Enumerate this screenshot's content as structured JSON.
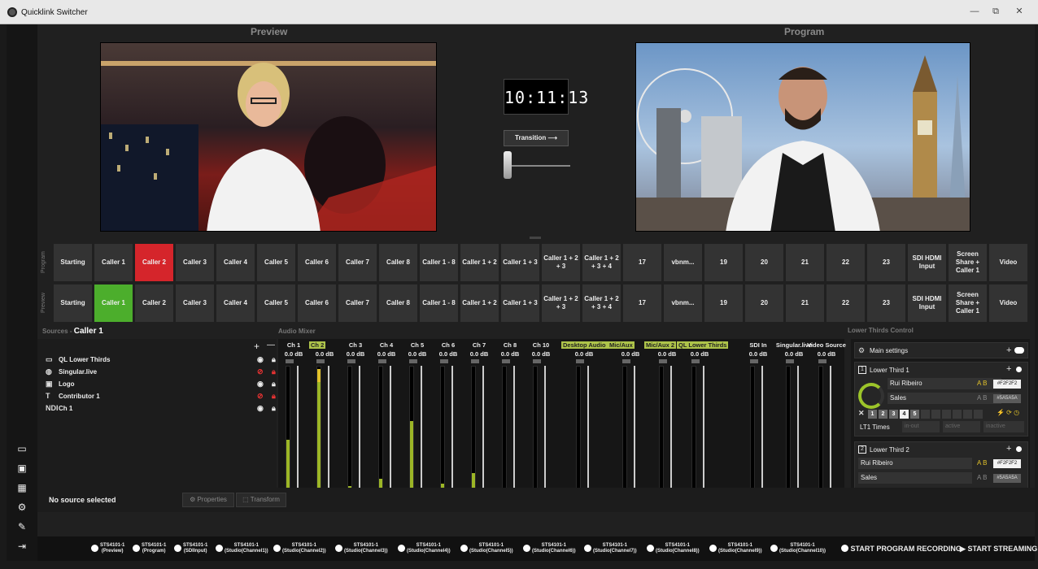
{
  "window": {
    "title": "Quicklink Switcher",
    "min": "—",
    "max": "⧉",
    "close": "✕"
  },
  "headers": {
    "preview": "Preview",
    "program": "Program"
  },
  "clock": "10:11:13",
  "transition_label": "Transition ⟶",
  "row_labels": {
    "program": "Program",
    "preview": "Preview"
  },
  "sources": [
    "Starting",
    "Caller 1",
    "Caller 2",
    "Caller 3",
    "Caller 4",
    "Caller 5",
    "Caller 6",
    "Caller 7",
    "Caller 8",
    "Caller 1 - 8",
    "Caller 1 + 2",
    "Caller 1 + 3",
    "Caller 1 + 2 + 3",
    "Caller 1 + 2 + 3 + 4",
    "17",
    "vbnm...",
    "19",
    "20",
    "21",
    "22",
    "23",
    "SDI HDMI Input",
    "Screen Share + Caller 1",
    "Video"
  ],
  "program_active": "Caller 2",
  "preview_active": "Caller 1",
  "sources_header": {
    "label": "Sources",
    "sep": "-",
    "current": "Caller 1"
  },
  "source_list": [
    {
      "name": "QL Lower Thirds",
      "icon": "▭",
      "hidden": false
    },
    {
      "name": "Singular.live",
      "icon": "◍",
      "hidden": true
    },
    {
      "name": "Logo",
      "icon": "▣",
      "hidden": false
    },
    {
      "name": "Contributor 1",
      "icon": "T",
      "hidden": true
    },
    {
      "name": "Ch 1",
      "icon": "NDI",
      "hidden": false
    }
  ],
  "source_controls": {
    "add": "+",
    "remove": "—"
  },
  "audio_mixer_label": "Audio Mixer",
  "mixer_channels": [
    {
      "name": "Ch 1",
      "db": "0.0 dB",
      "level": 0.44,
      "peak": 0,
      "hl": false,
      "muted": false
    },
    {
      "name": "Ch 2",
      "db": "0.0 dB",
      "level": 0.88,
      "peak": 0.1,
      "hl": true,
      "muted": false
    },
    {
      "name": "Ch 3",
      "db": "0.0 dB",
      "level": 0.08,
      "peak": 0,
      "hl": false,
      "muted": false
    },
    {
      "name": "Ch 4",
      "db": "0.0 dB",
      "level": 0.14,
      "peak": 0,
      "hl": false,
      "muted": false
    },
    {
      "name": "Ch 5",
      "db": "0.0 dB",
      "level": 0.58,
      "peak": 0,
      "hl": false,
      "muted": false
    },
    {
      "name": "Ch 6",
      "db": "0.0 dB",
      "level": 0.1,
      "peak": 0,
      "hl": false,
      "muted": false
    },
    {
      "name": "Ch 7",
      "db": "0.0 dB",
      "level": 0.18,
      "peak": 0,
      "hl": false,
      "muted": false
    },
    {
      "name": "Ch 8",
      "db": "0.0 dB",
      "level": 0.03,
      "peak": 0,
      "hl": false,
      "muted": false
    },
    {
      "name": "Ch 10",
      "db": "0.0 dB",
      "level": 0.07,
      "peak": 0,
      "hl": false,
      "muted": false
    },
    {
      "name": "Desktop Audio",
      "db": "0.0 dB",
      "level": 0,
      "peak": 0,
      "hl": true,
      "muted": true
    },
    {
      "name": "Mic/Aux",
      "db": "0.0 dB",
      "level": 0,
      "peak": 0,
      "hl": true,
      "muted": true
    },
    {
      "name": "Mic/Aux 2",
      "db": "0.0 dB",
      "level": 0,
      "peak": 0,
      "hl": true,
      "muted": true
    },
    {
      "name": "QL Lower Thirds",
      "db": "0.0 dB",
      "level": 0,
      "peak": 0,
      "hl": true,
      "muted": false
    },
    {
      "name": "SDI In",
      "db": "0.0 dB",
      "level": 0,
      "peak": 0,
      "hl": false,
      "muted": false
    },
    {
      "name": "Singular.live",
      "db": "0.0 dB",
      "level": 0,
      "peak": 0,
      "hl": false,
      "muted": false
    },
    {
      "name": "Video Source",
      "db": "0.0 dB",
      "level": 0,
      "peak": 0,
      "hl": false,
      "muted": false
    }
  ],
  "lower_thirds": {
    "label": "Lower Thirds Control",
    "main_settings": "Main settings",
    "items": [
      {
        "num": "1",
        "title": "Lower Third 1",
        "name": "Rui Ribeiro",
        "role": "Sales",
        "color1": "#F2F2F2",
        "color2": "#5A5A5A",
        "times_label": "LT1 Times",
        "in_out": "in-out",
        "active": "active",
        "inactive": "inactive"
      },
      {
        "num": "2",
        "title": "Lower Third 2",
        "name": "Rui Ribeiro",
        "role": "Sales",
        "color1": "#F2F2F2",
        "color2": "#5A5A5A"
      }
    ],
    "presets": [
      "1",
      "2",
      "3",
      "4",
      "5"
    ],
    "presets2": [
      "1",
      "2",
      "3",
      "4"
    ]
  },
  "bottom": {
    "no_source": "No source selected",
    "properties": "Properties",
    "transform": "Transform"
  },
  "recorders": [
    [
      "STS4101-1",
      "(Preview)"
    ],
    [
      "STS4101-1",
      "(Program)"
    ],
    [
      "STS4101-1",
      "(SDIInput)"
    ],
    [
      "STS4101-1",
      "(Studio(Channel1))"
    ],
    [
      "STS4101-1",
      "(Studio(Channel2))"
    ],
    [
      "STS4101-1",
      "(Studio(Channel3))"
    ],
    [
      "STS4101-1",
      "(Studio(Channel4))"
    ],
    [
      "STS4101-1",
      "(Studio(Channel5))"
    ],
    [
      "STS4101-1",
      "(Studio(Channel6))"
    ],
    [
      "STS4101-1",
      "(Studio(Channel7))"
    ],
    [
      "STS4101-1",
      "(Studio(Channel8))"
    ],
    [
      "STS4101-1",
      "(Studio(Channel9))"
    ],
    [
      "STS4101-1",
      "(Studio(Channel10))"
    ]
  ],
  "start_recording": "START PROGRAM RECORDING",
  "start_streaming": "START STREAMING"
}
